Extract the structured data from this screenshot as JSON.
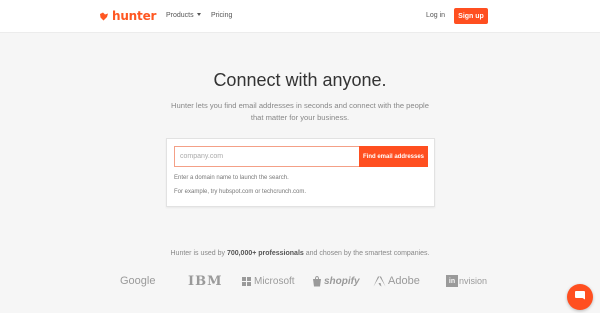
{
  "header": {
    "logo_text": "hunter",
    "nav": {
      "products": "Products",
      "pricing": "Pricing"
    },
    "login": "Log in",
    "signup": "Sign up"
  },
  "hero": {
    "title": "Connect with anyone.",
    "subtitle": "Hunter lets you find email addresses in seconds and connect with the people that matter for your business."
  },
  "search": {
    "placeholder": "company.com",
    "button": "Find email addresses",
    "hint1": "Enter a domain name to launch the search.",
    "hint2": "For example, try hubspot.com or techcrunch.com."
  },
  "trust": {
    "prefix": "Hunter is used by",
    "highlight": "700,000+ professionals",
    "suffix": "and chosen by the smartest companies."
  },
  "brands": [
    "Google",
    "IBM",
    "Microsoft",
    "shopify",
    "Adobe",
    "nvision"
  ],
  "brand_prefix_invision": "in",
  "colors": {
    "accent": "#ff4f20",
    "logo": "#ff5722"
  },
  "icons": {
    "logo": "hunter-logo-icon",
    "chat": "chat-icon",
    "products_caret": "chevron-down-icon"
  }
}
